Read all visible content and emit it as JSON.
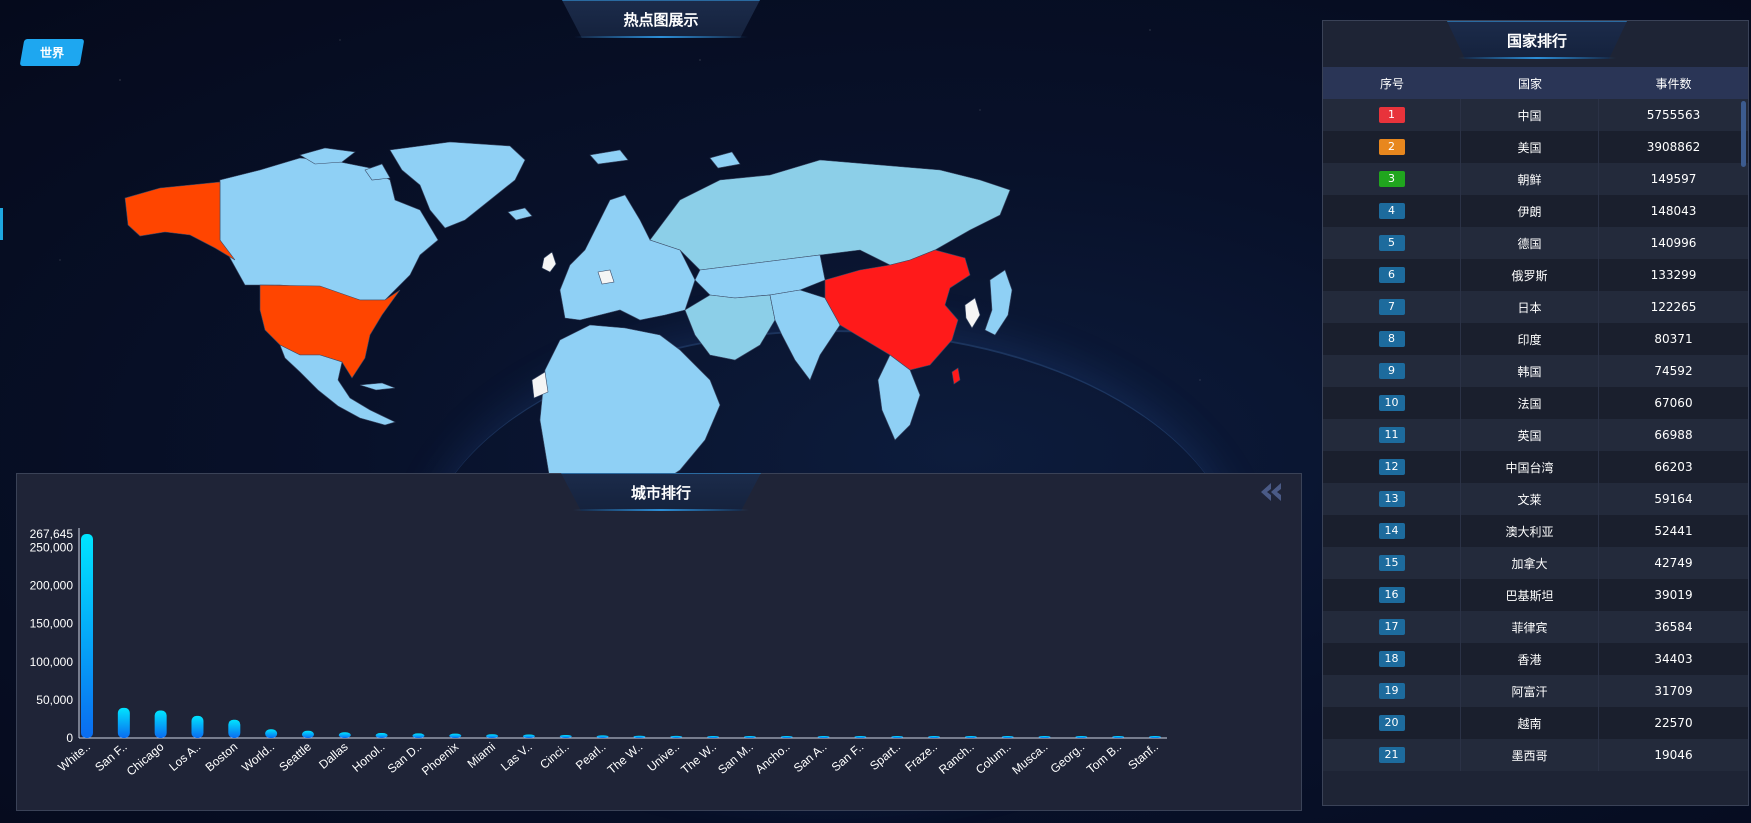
{
  "map": {
    "title": "热点图展示",
    "region_button": "世界"
  },
  "ranking": {
    "title": "国家排行",
    "headers": {
      "rank": "序号",
      "country": "国家",
      "count": "事件数"
    },
    "rows": [
      {
        "rank": "1",
        "country": "中国",
        "count": "5755563",
        "color": "#e8333b"
      },
      {
        "rank": "2",
        "country": "美国",
        "count": "3908862",
        "color": "#e8871e"
      },
      {
        "rank": "3",
        "country": "朝鲜",
        "count": "149597",
        "color": "#20a61e"
      },
      {
        "rank": "4",
        "country": "伊朗",
        "count": "148043",
        "color": "#1d6b9d"
      },
      {
        "rank": "5",
        "country": "德国",
        "count": "140996",
        "color": "#1d6b9d"
      },
      {
        "rank": "6",
        "country": "俄罗斯",
        "count": "133299",
        "color": "#1d6b9d"
      },
      {
        "rank": "7",
        "country": "日本",
        "count": "122265",
        "color": "#1d6b9d"
      },
      {
        "rank": "8",
        "country": "印度",
        "count": "80371",
        "color": "#1d6b9d"
      },
      {
        "rank": "9",
        "country": "韩国",
        "count": "74592",
        "color": "#1d6b9d"
      },
      {
        "rank": "10",
        "country": "法国",
        "count": "67060",
        "color": "#1d6b9d"
      },
      {
        "rank": "11",
        "country": "英国",
        "count": "66988",
        "color": "#1d6b9d"
      },
      {
        "rank": "12",
        "country": "中国台湾",
        "count": "66203",
        "color": "#1d6b9d"
      },
      {
        "rank": "13",
        "country": "文莱",
        "count": "59164",
        "color": "#1d6b9d"
      },
      {
        "rank": "14",
        "country": "澳大利亚",
        "count": "52441",
        "color": "#1d6b9d"
      },
      {
        "rank": "15",
        "country": "加拿大",
        "count": "42749",
        "color": "#1d6b9d"
      },
      {
        "rank": "16",
        "country": "巴基斯坦",
        "count": "39019",
        "color": "#1d6b9d"
      },
      {
        "rank": "17",
        "country": "菲律宾",
        "count": "36584",
        "color": "#1d6b9d"
      },
      {
        "rank": "18",
        "country": "香港",
        "count": "34403",
        "color": "#1d6b9d"
      },
      {
        "rank": "19",
        "country": "阿富汗",
        "count": "31709",
        "color": "#1d6b9d"
      },
      {
        "rank": "20",
        "country": "越南",
        "count": "22570",
        "color": "#1d6b9d"
      },
      {
        "rank": "21",
        "country": "墨西哥",
        "count": "19046",
        "color": "#1d6b9d"
      }
    ]
  },
  "city": {
    "title": "城市排行",
    "back_icon": "double-chevron-left-icon"
  },
  "chart_data": {
    "type": "bar",
    "categories": [
      "White..",
      "San F..",
      "Chicago",
      "Los A..",
      "Boston",
      "World..",
      "Seattle",
      "Dallas",
      "Honol..",
      "San D..",
      "Phoenix",
      "Miami",
      "Las V..",
      "Cinci..",
      "Pearl..",
      "The W..",
      "Unive..",
      "The W..",
      "San M..",
      "Ancho..",
      "San A..",
      "San F..",
      "Spart..",
      "Fraze..",
      "Ranch..",
      "Colum..",
      "Musca..",
      "Georg..",
      "Tom B..",
      "Stanf.."
    ],
    "values": [
      267645,
      39500,
      36000,
      29000,
      24000,
      11500,
      9500,
      7500,
      6500,
      6000,
      5800,
      5000,
      4600,
      4000,
      3500,
      3000,
      2800,
      2600,
      2400,
      2300,
      2200,
      2100,
      2000,
      1900,
      1800,
      1700,
      1600,
      1500,
      1400,
      1300
    ],
    "ylim": [
      0,
      267645
    ],
    "yticks": [
      "0",
      "50,000",
      "100,000",
      "150,000",
      "200,000",
      "250,000",
      "267,645"
    ],
    "ytick_values": [
      0,
      50000,
      100000,
      150000,
      200000,
      250000,
      267645
    ],
    "bar_gradient": [
      "#00e5ff",
      "#0a6cf0"
    ],
    "grid": false
  },
  "map_colors": {
    "ocean": "#07112a",
    "default_land": "#8fd0f5",
    "china": "#ff1a1a",
    "usa": "#ff4500",
    "low": "#f5f5f5"
  }
}
